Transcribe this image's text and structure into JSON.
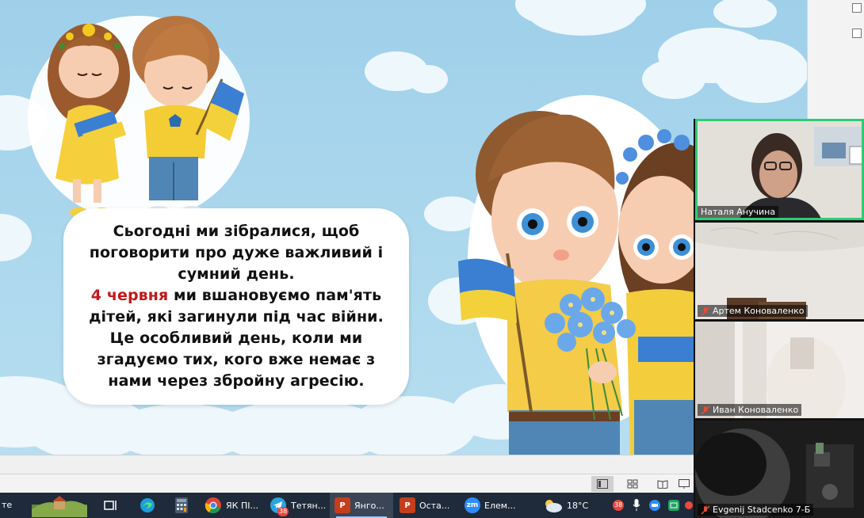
{
  "slide": {
    "speech_line1": "Сьогодні ми зібралися, щоб",
    "speech_line2": "поговорити про дуже важливий і",
    "speech_line3": "сумний день.",
    "speech_date": "4 червня",
    "speech_line4_rest": " ми вшановуємо пам'ять",
    "speech_line5": "дітей, які загинули під час війни.",
    "speech_line6": "Це особливий день, коли ми",
    "speech_line7": "згадуємо тих, кого вже немає з",
    "speech_line8": "нами через збройну агресію.",
    "date_color": "#c2181b"
  },
  "video_call": {
    "participants": [
      {
        "name": "Наталя Анучина",
        "muted": false,
        "speaking": true
      },
      {
        "name": "Артем Коноваленко",
        "muted": true,
        "speaking": false
      },
      {
        "name": "Иван Коноваленко",
        "muted": true,
        "speaking": false
      },
      {
        "name": "Evgenij Stadcenko 7-Б",
        "muted": true,
        "speaking": false
      }
    ],
    "accent_color": "#2ecc71"
  },
  "taskbar": {
    "left_text": "те",
    "items": [
      {
        "label": "ЯК ПІ...",
        "icon": "chrome-icon"
      },
      {
        "label": "Тетян...",
        "icon": "telegram-icon",
        "badge": "38"
      },
      {
        "label": "Янго...",
        "icon": "powerpoint-icon",
        "active": true
      },
      {
        "label": "Оста...",
        "icon": "powerpoint-icon"
      },
      {
        "label": "Елем...",
        "icon": "zoom-icon"
      }
    ],
    "weather": "18°C",
    "tray_badge": "38"
  }
}
